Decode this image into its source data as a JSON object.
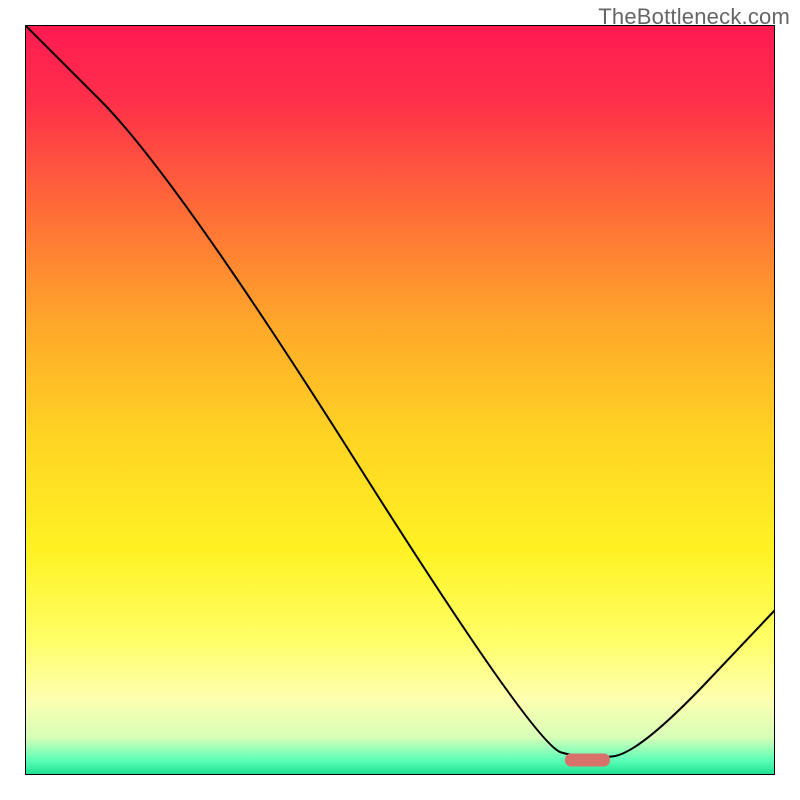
{
  "watermark": "TheBottleneck.com",
  "chart_data": {
    "type": "line",
    "title": "",
    "xlabel": "",
    "ylabel": "",
    "xlim": [
      0,
      100
    ],
    "ylim": [
      0,
      100
    ],
    "grid": false,
    "series": [
      {
        "name": "bottleneck-curve",
        "x": [
          0,
          20,
          68,
          75,
          82,
          100
        ],
        "values": [
          100,
          80,
          4,
          2,
          3,
          22
        ]
      }
    ],
    "marker": {
      "name": "optimal-point",
      "x_center": 75,
      "y": 2,
      "width_pct": 6,
      "color": "#d9716b"
    },
    "background_gradient": {
      "stops": [
        {
          "pos": 0,
          "color": "#ff1a51"
        },
        {
          "pos": 0.1,
          "color": "#ff2f4a"
        },
        {
          "pos": 0.25,
          "color": "#ff6d37"
        },
        {
          "pos": 0.4,
          "color": "#ffa82a"
        },
        {
          "pos": 0.55,
          "color": "#ffd423"
        },
        {
          "pos": 0.7,
          "color": "#fff223"
        },
        {
          "pos": 0.82,
          "color": "#ffff67"
        },
        {
          "pos": 0.9,
          "color": "#fdffb0"
        },
        {
          "pos": 0.95,
          "color": "#d7ffb8"
        },
        {
          "pos": 0.965,
          "color": "#9affb8"
        },
        {
          "pos": 0.98,
          "color": "#5effb8"
        },
        {
          "pos": 1.0,
          "color": "#18e08e"
        }
      ]
    },
    "border_color": "#000000",
    "border_width": 2,
    "line_color": "#000000",
    "line_width": 2
  }
}
